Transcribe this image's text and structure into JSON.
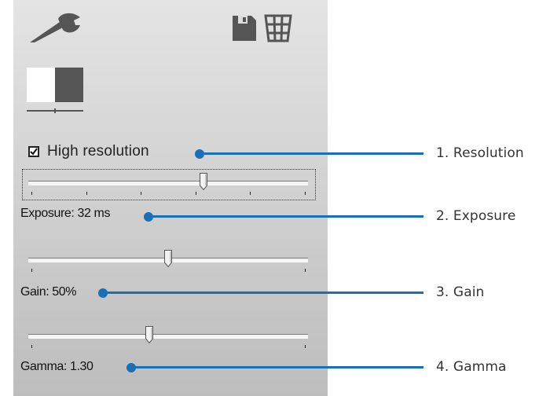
{
  "toolbar": {
    "settings_icon": "wrench-icon",
    "save_icon": "floppy-disk-icon",
    "grid_icon": "grid-basket-icon",
    "contrast_icon": "contrast-split-icon"
  },
  "controls": {
    "high_resolution": {
      "label": "High resolution",
      "checked": true
    },
    "exposure": {
      "label": "Exposure: 32 ms",
      "level": 0.63
    },
    "gain": {
      "label": "Gain: 50%",
      "level": 0.5
    },
    "gamma": {
      "label": "Gamma: 1.30",
      "level": 0.43
    }
  },
  "callouts": [
    {
      "text": "1. Resolution"
    },
    {
      "text": "2. Exposure"
    },
    {
      "text": "3. Gain"
    },
    {
      "text": "4. Gamma"
    }
  ],
  "colors": {
    "callout": "#1a6fb5",
    "icon_dark": "#555555"
  }
}
